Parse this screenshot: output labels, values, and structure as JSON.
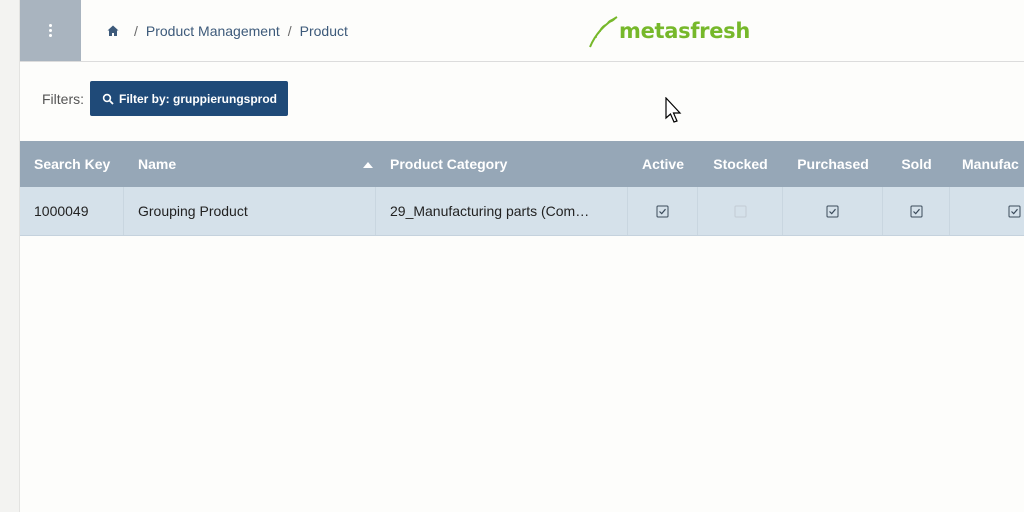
{
  "header": {
    "breadcrumb": [
      "Product Management",
      "Product"
    ],
    "logo_text": "metasfresh",
    "separator": "/"
  },
  "filters": {
    "label": "Filters:",
    "active_filter": "Filter by: gruppierungsprod"
  },
  "grid": {
    "columns": [
      "Search Key",
      "Name",
      "Product Category",
      "Active",
      "Stocked",
      "Purchased",
      "Sold",
      "Manufac"
    ],
    "sort": {
      "column": "Name",
      "direction": "ascending"
    },
    "rows": [
      {
        "search_key": "1000049",
        "name": "Grouping Product",
        "product_category": "29_Manufacturing parts (Com…",
        "active": true,
        "stocked": false,
        "purchased": true,
        "sold": true,
        "manufactured": true
      }
    ]
  },
  "colors": {
    "accent": "#1f4a78",
    "grid_header": "#96a7b7",
    "row_selected": "#d5e1ea",
    "logo_green": "#76b82a"
  }
}
